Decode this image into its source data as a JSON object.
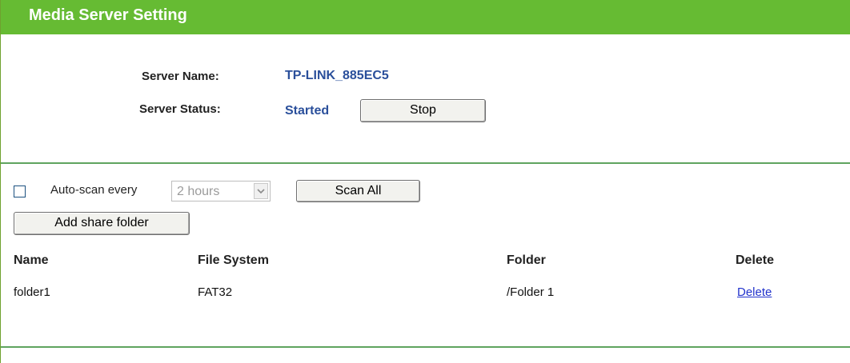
{
  "header": {
    "title": "Media Server Setting"
  },
  "server": {
    "name_label": "Server Name:",
    "name_value": "TP-LINK_885EC5",
    "status_label": "Server Status:",
    "status_value": "Started",
    "stop_label": "Stop"
  },
  "scan": {
    "auto_scan_label": "Auto-scan every",
    "auto_scan_checked": false,
    "interval_selected": "2 hours",
    "scan_all_label": "Scan All",
    "add_share_label": "Add share folder"
  },
  "table": {
    "headers": [
      "Name",
      "File System",
      "Folder",
      "Delete"
    ],
    "rows": [
      {
        "name": "folder1",
        "file_system": "FAT32",
        "folder": "/Folder 1",
        "delete": "Delete"
      }
    ]
  },
  "colors": {
    "header_bg": "#66bb33",
    "value_blue": "#2a4f9b",
    "link_blue": "#2233cc",
    "rule_green": "#5fa45f"
  },
  "icons": {
    "dropdown": "chevron-down-icon"
  }
}
